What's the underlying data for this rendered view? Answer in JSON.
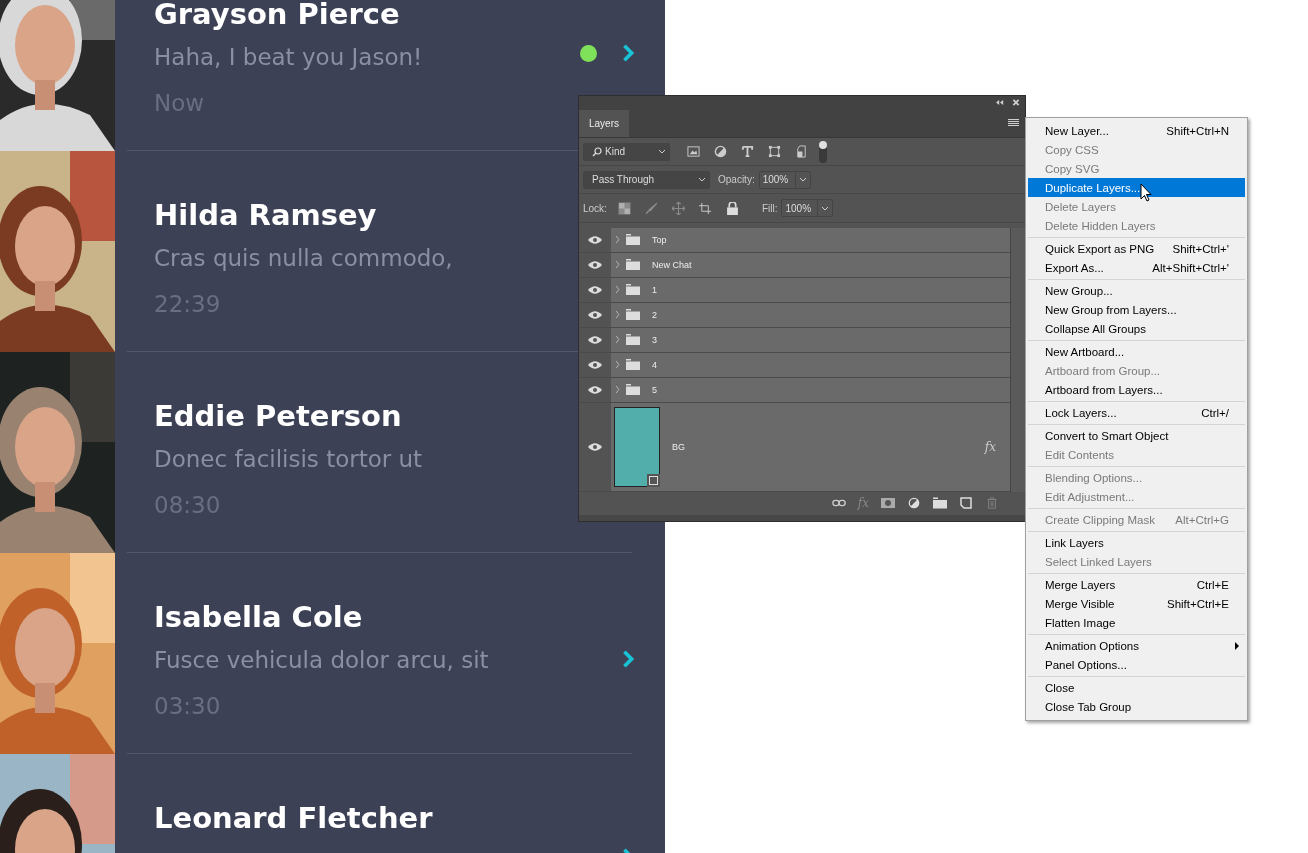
{
  "chats": [
    {
      "name": "Grayson Pierce",
      "message": "Haha, I beat you Jason!",
      "time": "Now",
      "online": true,
      "unread": true
    },
    {
      "name": "Hilda Ramsey",
      "message": "Cras quis nulla commodo,",
      "time": "22:39",
      "online": false,
      "unread": false
    },
    {
      "name": "Eddie Peterson",
      "message": "Donec facilisis tortor ut",
      "time": "08:30",
      "online": false,
      "unread": false
    },
    {
      "name": "Isabella Cole",
      "message": "Fusce vehicula dolor arcu, sit",
      "time": "03:30",
      "online": false,
      "unread": true
    },
    {
      "name": "Leonard Fletcher",
      "online": false,
      "unread": true
    }
  ],
  "layers_panel": {
    "tab": "Layers",
    "filter": "Kind",
    "blend_mode": "Pass Through",
    "opacity_label": "Opacity:",
    "opacity": "100%",
    "lock_label": "Lock:",
    "fill_label": "Fill:",
    "fill": "100%",
    "layers": [
      {
        "name": "Top",
        "kind": "group"
      },
      {
        "name": "New Chat",
        "kind": "group"
      },
      {
        "name": "1",
        "kind": "group"
      },
      {
        "name": "2",
        "kind": "group"
      },
      {
        "name": "3",
        "kind": "group"
      },
      {
        "name": "4",
        "kind": "group"
      },
      {
        "name": "5",
        "kind": "group"
      },
      {
        "name": "BG",
        "kind": "artboard",
        "effects": "fx"
      }
    ],
    "toolbar_effects": "fx"
  },
  "menu": [
    [
      {
        "label": "New Layer...",
        "shortcut": "Shift+Ctrl+N",
        "disabled": false,
        "selected": false
      },
      {
        "label": "Copy CSS",
        "disabled": true,
        "selected": false
      },
      {
        "label": "Copy SVG",
        "disabled": true,
        "selected": false
      },
      {
        "label": "Duplicate Layers...",
        "disabled": false,
        "selected": true
      },
      {
        "label": "Delete Layers",
        "disabled": true,
        "selected": false
      },
      {
        "label": "Delete Hidden Layers",
        "disabled": true,
        "selected": false
      }
    ],
    [
      {
        "label": "Quick Export as PNG",
        "shortcut": "Shift+Ctrl+'",
        "disabled": false,
        "selected": false
      },
      {
        "label": "Export As...",
        "shortcut": "Alt+Shift+Ctrl+'",
        "disabled": false,
        "selected": false
      }
    ],
    [
      {
        "label": "New Group...",
        "disabled": false,
        "selected": false
      },
      {
        "label": "New Group from Layers...",
        "disabled": false,
        "selected": false
      },
      {
        "label": "Collapse All Groups",
        "disabled": false,
        "selected": false
      }
    ],
    [
      {
        "label": "New Artboard...",
        "disabled": false,
        "selected": false
      },
      {
        "label": "Artboard from Group...",
        "disabled": true,
        "selected": false
      },
      {
        "label": "Artboard from Layers...",
        "disabled": false,
        "selected": false
      }
    ],
    [
      {
        "label": "Lock Layers...",
        "shortcut": "Ctrl+/",
        "disabled": false,
        "selected": false
      }
    ],
    [
      {
        "label": "Convert to Smart Object",
        "disabled": false,
        "selected": false
      },
      {
        "label": "Edit Contents",
        "disabled": true,
        "selected": false
      }
    ],
    [
      {
        "label": "Blending Options...",
        "disabled": true,
        "selected": false
      },
      {
        "label": "Edit Adjustment...",
        "disabled": true,
        "selected": false
      }
    ],
    [
      {
        "label": "Create Clipping Mask",
        "shortcut": "Alt+Ctrl+G",
        "disabled": true,
        "selected": false
      }
    ],
    [
      {
        "label": "Link Layers",
        "disabled": false,
        "selected": false
      },
      {
        "label": "Select Linked Layers",
        "disabled": true,
        "selected": false
      }
    ],
    [
      {
        "label": "Merge Layers",
        "shortcut": "Ctrl+E",
        "disabled": false,
        "selected": false
      },
      {
        "label": "Merge Visible",
        "shortcut": "Shift+Ctrl+E",
        "disabled": false,
        "selected": false
      },
      {
        "label": "Flatten Image",
        "disabled": false,
        "selected": false
      }
    ],
    [
      {
        "label": "Animation Options",
        "submenu": true,
        "disabled": false,
        "selected": false
      },
      {
        "label": "Panel Options...",
        "disabled": false,
        "selected": false
      }
    ],
    [
      {
        "label": "Close",
        "disabled": false,
        "selected": false
      },
      {
        "label": "Close Tab Group",
        "disabled": false,
        "selected": false
      }
    ]
  ]
}
